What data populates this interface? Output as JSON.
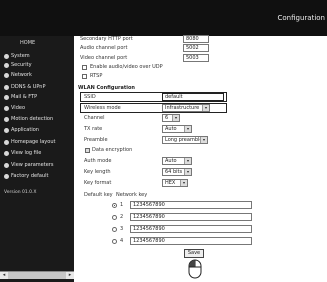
{
  "header": {
    "title": "Configuration"
  },
  "sidebar": {
    "home": "HOME",
    "items": [
      {
        "label": "System",
        "icon": "arrow-bullet-icon"
      },
      {
        "label": "Security",
        "icon": "arrow-bullet-icon"
      },
      {
        "label": "Network",
        "icon": "arrow-bullet-icon"
      },
      {
        "label": "DDNS & UPnP",
        "icon": "arrow-bullet-icon"
      },
      {
        "label": "Mail & FTP",
        "icon": "arrow-bullet-icon"
      },
      {
        "label": "Video",
        "icon": "arrow-bullet-icon"
      },
      {
        "label": "Motion detection",
        "icon": "arrow-bullet-icon"
      },
      {
        "label": "Application",
        "icon": "arrow-bullet-icon"
      },
      {
        "label": "Homepage layout",
        "icon": "arrow-bullet-icon"
      },
      {
        "label": "View log file",
        "icon": "arrow-bullet-icon"
      },
      {
        "label": "View parameters",
        "icon": "arrow-bullet-icon"
      },
      {
        "label": "Factory default",
        "icon": "arrow-bullet-icon"
      }
    ],
    "version": "Version 01.0.X",
    "scroll_left": "◂",
    "scroll_right": "▸"
  },
  "top_fields": [
    {
      "label": "Secondary HTTP port",
      "value": "8080"
    },
    {
      "label": "Audio channel port",
      "value": "5002"
    },
    {
      "label": "Video channel port",
      "value": "5003"
    }
  ],
  "upnp_checkbox": {
    "label": "Enable audio/video over UDP",
    "checked": false
  },
  "rtsp_checkbox": {
    "label": "RTSP",
    "checked": false
  },
  "wlan": {
    "title": "WLAN Configuration",
    "ssid_label": "SSID",
    "ssid_value": "default",
    "mode_label": "Wireless mode",
    "mode_value": "Infrastructure",
    "channel_label": "Channel",
    "channel_value": "6",
    "txrate_label": "TX rate",
    "txrate_value": "Auto",
    "preamble_label": "Preamble",
    "preamble_value": "Long preamble",
    "encryption_label": "Data encryption",
    "encryption_checked": true,
    "authmode_label": "Auth mode",
    "authmode_value": "Auto",
    "keylength_label": "Key length",
    "keylength_value": "64 bits",
    "keyformat_label": "Key format",
    "keyformat_value": "HEX",
    "defaultkey_label": "Default key",
    "networkkey_label": "Network key",
    "keys": [
      {
        "index": "1",
        "value": "1234567890",
        "selected": true
      },
      {
        "index": "2",
        "value": "1234567890",
        "selected": false
      },
      {
        "index": "3",
        "value": "1234567890",
        "selected": false
      },
      {
        "index": "4",
        "value": "1234567890",
        "selected": false
      }
    ],
    "save_label": "Save"
  }
}
